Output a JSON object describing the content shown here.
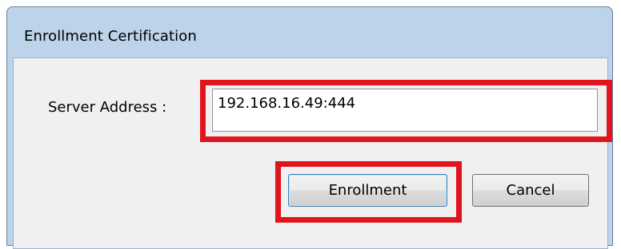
{
  "dialog": {
    "title": "Enrollment Certification",
    "server_address_label": "Server Address :",
    "server_address_value": "192.168.16.49:444",
    "enrollment_button_label": "Enrollment",
    "cancel_button_label": "Cancel"
  },
  "colors": {
    "highlight_box": "#e1141e",
    "window_frame": "#bcd3ea",
    "client_background": "#f0f0f0"
  }
}
